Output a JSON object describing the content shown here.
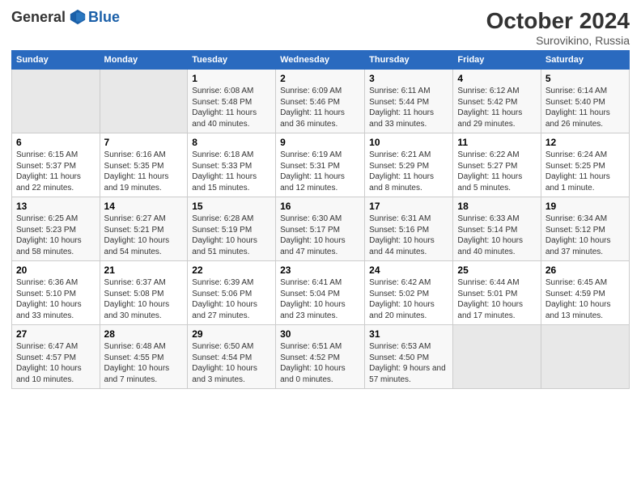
{
  "header": {
    "logo_general": "General",
    "logo_blue": "Blue",
    "title": "October 2024",
    "subtitle": "Surovikino, Russia"
  },
  "weekdays": [
    "Sunday",
    "Monday",
    "Tuesday",
    "Wednesday",
    "Thursday",
    "Friday",
    "Saturday"
  ],
  "weeks": [
    [
      {
        "day": "",
        "empty": true
      },
      {
        "day": "",
        "empty": true
      },
      {
        "day": "1",
        "sunrise": "Sunrise: 6:08 AM",
        "sunset": "Sunset: 5:48 PM",
        "daylight": "Daylight: 11 hours and 40 minutes."
      },
      {
        "day": "2",
        "sunrise": "Sunrise: 6:09 AM",
        "sunset": "Sunset: 5:46 PM",
        "daylight": "Daylight: 11 hours and 36 minutes."
      },
      {
        "day": "3",
        "sunrise": "Sunrise: 6:11 AM",
        "sunset": "Sunset: 5:44 PM",
        "daylight": "Daylight: 11 hours and 33 minutes."
      },
      {
        "day": "4",
        "sunrise": "Sunrise: 6:12 AM",
        "sunset": "Sunset: 5:42 PM",
        "daylight": "Daylight: 11 hours and 29 minutes."
      },
      {
        "day": "5",
        "sunrise": "Sunrise: 6:14 AM",
        "sunset": "Sunset: 5:40 PM",
        "daylight": "Daylight: 11 hours and 26 minutes."
      }
    ],
    [
      {
        "day": "6",
        "sunrise": "Sunrise: 6:15 AM",
        "sunset": "Sunset: 5:37 PM",
        "daylight": "Daylight: 11 hours and 22 minutes."
      },
      {
        "day": "7",
        "sunrise": "Sunrise: 6:16 AM",
        "sunset": "Sunset: 5:35 PM",
        "daylight": "Daylight: 11 hours and 19 minutes."
      },
      {
        "day": "8",
        "sunrise": "Sunrise: 6:18 AM",
        "sunset": "Sunset: 5:33 PM",
        "daylight": "Daylight: 11 hours and 15 minutes."
      },
      {
        "day": "9",
        "sunrise": "Sunrise: 6:19 AM",
        "sunset": "Sunset: 5:31 PM",
        "daylight": "Daylight: 11 hours and 12 minutes."
      },
      {
        "day": "10",
        "sunrise": "Sunrise: 6:21 AM",
        "sunset": "Sunset: 5:29 PM",
        "daylight": "Daylight: 11 hours and 8 minutes."
      },
      {
        "day": "11",
        "sunrise": "Sunrise: 6:22 AM",
        "sunset": "Sunset: 5:27 PM",
        "daylight": "Daylight: 11 hours and 5 minutes."
      },
      {
        "day": "12",
        "sunrise": "Sunrise: 6:24 AM",
        "sunset": "Sunset: 5:25 PM",
        "daylight": "Daylight: 11 hours and 1 minute."
      }
    ],
    [
      {
        "day": "13",
        "sunrise": "Sunrise: 6:25 AM",
        "sunset": "Sunset: 5:23 PM",
        "daylight": "Daylight: 10 hours and 58 minutes."
      },
      {
        "day": "14",
        "sunrise": "Sunrise: 6:27 AM",
        "sunset": "Sunset: 5:21 PM",
        "daylight": "Daylight: 10 hours and 54 minutes."
      },
      {
        "day": "15",
        "sunrise": "Sunrise: 6:28 AM",
        "sunset": "Sunset: 5:19 PM",
        "daylight": "Daylight: 10 hours and 51 minutes."
      },
      {
        "day": "16",
        "sunrise": "Sunrise: 6:30 AM",
        "sunset": "Sunset: 5:17 PM",
        "daylight": "Daylight: 10 hours and 47 minutes."
      },
      {
        "day": "17",
        "sunrise": "Sunrise: 6:31 AM",
        "sunset": "Sunset: 5:16 PM",
        "daylight": "Daylight: 10 hours and 44 minutes."
      },
      {
        "day": "18",
        "sunrise": "Sunrise: 6:33 AM",
        "sunset": "Sunset: 5:14 PM",
        "daylight": "Daylight: 10 hours and 40 minutes."
      },
      {
        "day": "19",
        "sunrise": "Sunrise: 6:34 AM",
        "sunset": "Sunset: 5:12 PM",
        "daylight": "Daylight: 10 hours and 37 minutes."
      }
    ],
    [
      {
        "day": "20",
        "sunrise": "Sunrise: 6:36 AM",
        "sunset": "Sunset: 5:10 PM",
        "daylight": "Daylight: 10 hours and 33 minutes."
      },
      {
        "day": "21",
        "sunrise": "Sunrise: 6:37 AM",
        "sunset": "Sunset: 5:08 PM",
        "daylight": "Daylight: 10 hours and 30 minutes."
      },
      {
        "day": "22",
        "sunrise": "Sunrise: 6:39 AM",
        "sunset": "Sunset: 5:06 PM",
        "daylight": "Daylight: 10 hours and 27 minutes."
      },
      {
        "day": "23",
        "sunrise": "Sunrise: 6:41 AM",
        "sunset": "Sunset: 5:04 PM",
        "daylight": "Daylight: 10 hours and 23 minutes."
      },
      {
        "day": "24",
        "sunrise": "Sunrise: 6:42 AM",
        "sunset": "Sunset: 5:02 PM",
        "daylight": "Daylight: 10 hours and 20 minutes."
      },
      {
        "day": "25",
        "sunrise": "Sunrise: 6:44 AM",
        "sunset": "Sunset: 5:01 PM",
        "daylight": "Daylight: 10 hours and 17 minutes."
      },
      {
        "day": "26",
        "sunrise": "Sunrise: 6:45 AM",
        "sunset": "Sunset: 4:59 PM",
        "daylight": "Daylight: 10 hours and 13 minutes."
      }
    ],
    [
      {
        "day": "27",
        "sunrise": "Sunrise: 6:47 AM",
        "sunset": "Sunset: 4:57 PM",
        "daylight": "Daylight: 10 hours and 10 minutes."
      },
      {
        "day": "28",
        "sunrise": "Sunrise: 6:48 AM",
        "sunset": "Sunset: 4:55 PM",
        "daylight": "Daylight: 10 hours and 7 minutes."
      },
      {
        "day": "29",
        "sunrise": "Sunrise: 6:50 AM",
        "sunset": "Sunset: 4:54 PM",
        "daylight": "Daylight: 10 hours and 3 minutes."
      },
      {
        "day": "30",
        "sunrise": "Sunrise: 6:51 AM",
        "sunset": "Sunset: 4:52 PM",
        "daylight": "Daylight: 10 hours and 0 minutes."
      },
      {
        "day": "31",
        "sunrise": "Sunrise: 6:53 AM",
        "sunset": "Sunset: 4:50 PM",
        "daylight": "Daylight: 9 hours and 57 minutes."
      },
      {
        "day": "",
        "empty": true
      },
      {
        "day": "",
        "empty": true
      }
    ]
  ]
}
